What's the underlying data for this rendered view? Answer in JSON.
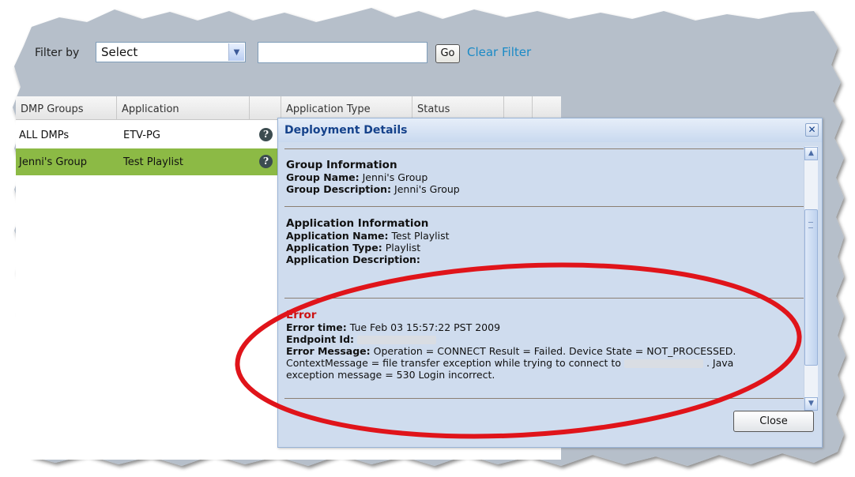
{
  "filter": {
    "label": "Filter by",
    "select_value": "Select",
    "input_value": "",
    "go_label": "Go",
    "clear_label": "Clear Filter"
  },
  "table": {
    "headers": [
      "DMP Groups",
      "Application",
      "",
      "Application Type",
      "Status",
      "",
      ""
    ],
    "rows": [
      {
        "group": "ALL DMPs",
        "application": "ETV-PG",
        "selected": false
      },
      {
        "group": "Jenni's Group",
        "application": "Test Playlist",
        "selected": true
      }
    ]
  },
  "modal": {
    "title": "Deployment Details",
    "group_section": {
      "heading": "Group Information",
      "name_key": "Group Name:",
      "name_value": "Jenni's Group",
      "desc_key": "Group Description:",
      "desc_value": "Jenni's Group"
    },
    "app_section": {
      "heading": "Application Information",
      "name_key": "Application Name:",
      "name_value": "Test Playlist",
      "type_key": "Application Type:",
      "type_value": "Playlist",
      "desc_key": "Application Description:",
      "desc_value": ""
    },
    "error_section": {
      "heading": "Error",
      "time_key": "Error time:",
      "time_value": "Tue Feb 03 15:57:22 PST 2009",
      "endpoint_key": "Endpoint Id:",
      "message_key": "Error Message:",
      "message_line1": "Operation = CONNECT Result = Failed. Device State = NOT_PROCESSED.",
      "message_line2_a": "ContextMessage = file transfer exception while trying to connect to",
      "message_line2_b": ". Java",
      "message_line3": "exception message = 530 Login incorrect."
    },
    "close_label": "Close"
  },
  "colors": {
    "selected_row": "#8cba45",
    "link": "#1a8ac6",
    "modal_title": "#15428b",
    "error_red": "#cc1212",
    "highlight_ellipse": "#e0141a"
  }
}
